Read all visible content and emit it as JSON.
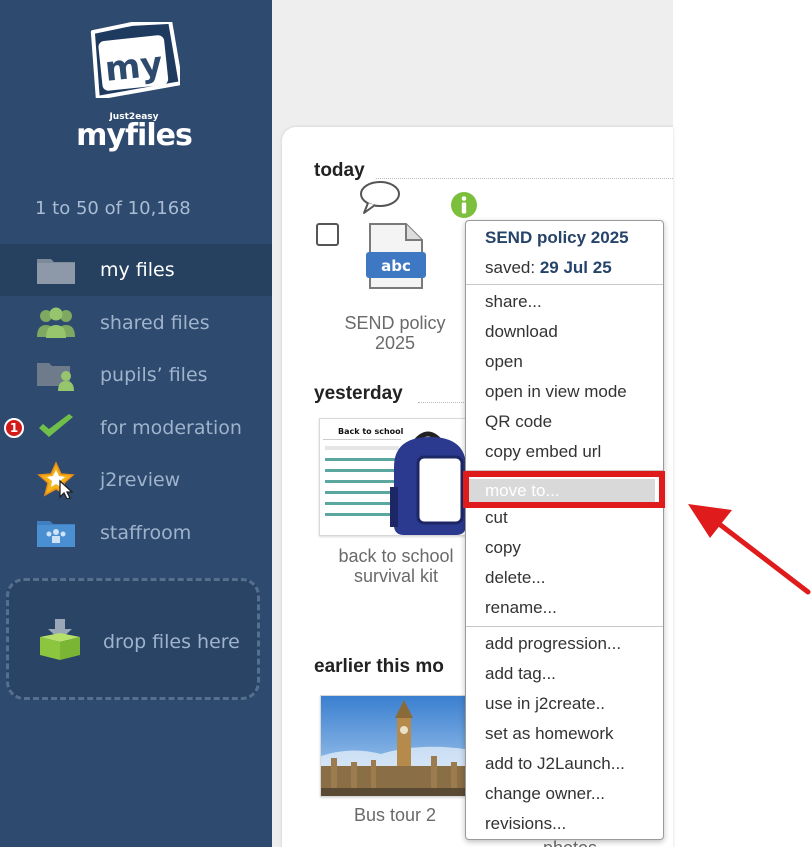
{
  "app": {
    "logo_sub": "Just2easy",
    "logo_main_my": "my",
    "logo_main_files": "files",
    "logo_box_text": "my"
  },
  "sidebar": {
    "count": "1 to 50 of 10,168",
    "items": [
      {
        "label": "my files",
        "icon": "folder-icon",
        "active": true
      },
      {
        "label": "shared files",
        "icon": "people-icon"
      },
      {
        "label": "pupils’ files",
        "icon": "pupil-folder-icon"
      },
      {
        "label": "for moderation",
        "icon": "checkmark-icon",
        "badge": "1"
      },
      {
        "label": "j2review",
        "icon": "star-icon"
      },
      {
        "label": "staffroom",
        "icon": "staffroom-folder-icon"
      }
    ],
    "dropzone_label": "drop files here"
  },
  "main": {
    "sections": {
      "today": "today",
      "yesterday": "yesterday",
      "earlier": "earlier this mo"
    },
    "files": {
      "send_policy": {
        "caption_line1": "SEND policy",
        "caption_line2": "2025",
        "icon_text": "abc"
      },
      "back_to_school": {
        "caption_line1": "back to school",
        "caption_line2": "survival kit",
        "thumb_title": "Back to school"
      },
      "bus_tour": {
        "caption": "Bus tour 2"
      },
      "photos_partial": {
        "caption": "photos"
      }
    }
  },
  "context_menu": {
    "title": "SEND policy 2025",
    "saved_label": "saved:",
    "saved_date": "29 Jul 25",
    "group1": [
      "share...",
      "download",
      "open",
      "open in view mode",
      "QR code",
      "copy embed url"
    ],
    "group2": [
      "move to...",
      "cut",
      "copy",
      "delete...",
      "rename..."
    ],
    "group3": [
      "add progression...",
      "add tag...",
      "use in j2create..",
      "set as homework",
      "add to J2Launch...",
      "change owner...",
      "revisions..."
    ],
    "highlighted": "move to..."
  },
  "colors": {
    "sidebar_bg": "#2e4a6e",
    "accent_red": "#e01b1b",
    "menu_title": "#26436a"
  }
}
